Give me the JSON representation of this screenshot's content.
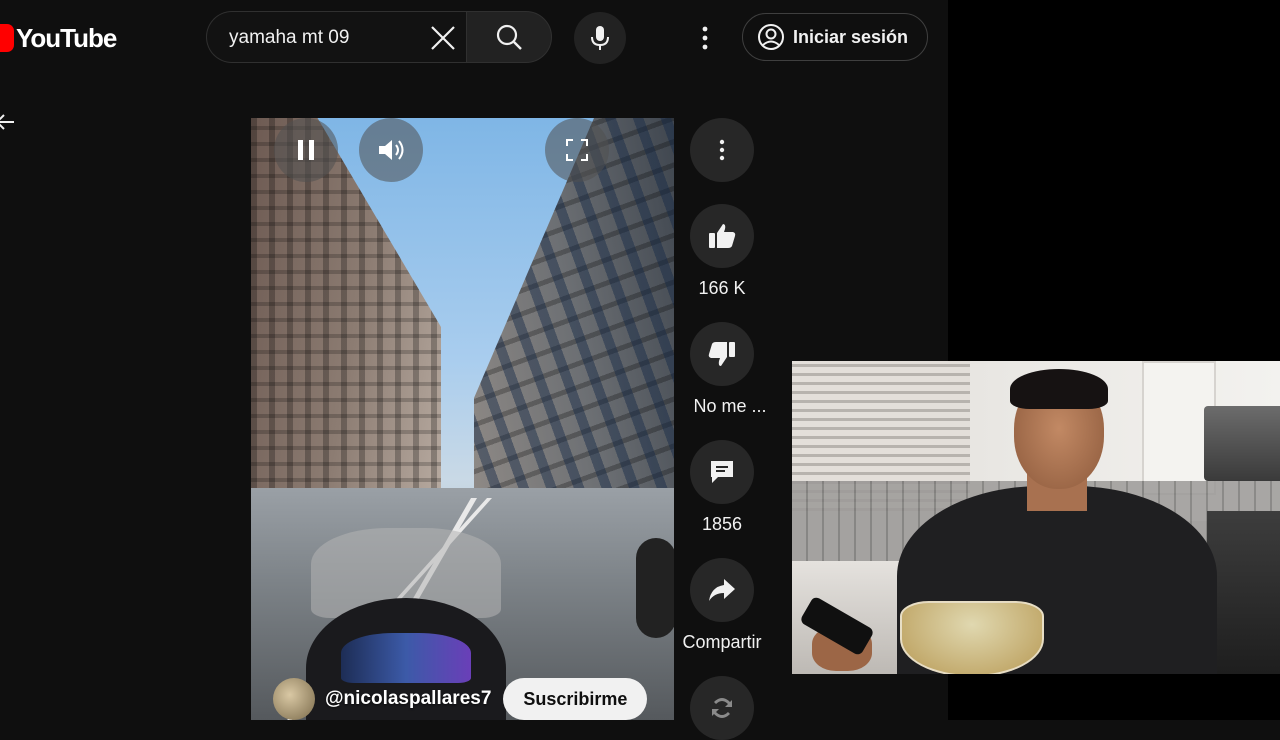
{
  "header": {
    "logo_text": "YouTube",
    "search_value": "yamaha mt 09",
    "signin_label": "Iniciar sesión"
  },
  "short": {
    "channel_name": "@nicolaspallares7",
    "subscribe_label": "Suscribirme",
    "likes": "166 K",
    "dislike_label": "No me ...",
    "comments": "1856",
    "share_label": "Compartir"
  },
  "colors": {
    "background": "#0f0f0f",
    "brand_red": "#ff0000",
    "button_bg": "#272727"
  },
  "icons": [
    "back-arrow-icon",
    "clear-icon",
    "search-icon",
    "mic-icon",
    "more-vert-icon",
    "account-icon",
    "pause-icon",
    "volume-icon",
    "fullscreen-icon",
    "thumbs-up-icon",
    "thumbs-down-icon",
    "comment-icon",
    "share-icon",
    "remix-icon"
  ]
}
